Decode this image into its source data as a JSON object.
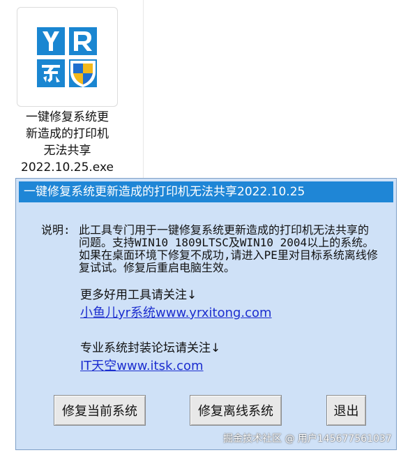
{
  "file": {
    "name_lines": [
      "一键修复系统更",
      "新造成的打印机",
      "无法共享",
      "2022.10.25.exe"
    ],
    "icon": "yr-system-logo-icon",
    "colors": {
      "blue": "#1a86d1",
      "shield_blue": "#1f6fcf",
      "shield_yellow": "#f3b81b"
    }
  },
  "dialog": {
    "title": "一键修复系统更新造成的打印机无法共享2022.10.25",
    "description_label": "说明:",
    "description": "此工具专门用于一键修复系统更新造成的打印机无法共享的问题。支持WIN10 1809LTSC及WIN10 2004以上的系统。如果在桌面环境下修复不成功,请进入PE里对目标系统离线修复试试。修复后重启电脑生效。",
    "more_tools_label": "更多好用工具请关注↓",
    "more_tools_link": "小鱼儿yr系统www.yrxitong.com",
    "forum_label": "专业系统封装论坛请关注↓",
    "forum_link": "IT天空www.itsk.com",
    "buttons": {
      "repair_current": "修复当前系统",
      "repair_offline": "修复离线系统",
      "exit": "退出"
    },
    "colors": {
      "titlebar": "#1f86d6",
      "background": "#cfe1f7",
      "link": "#1c2ecf"
    }
  },
  "watermark": "掘金技术社区 @ 用户145677561037"
}
